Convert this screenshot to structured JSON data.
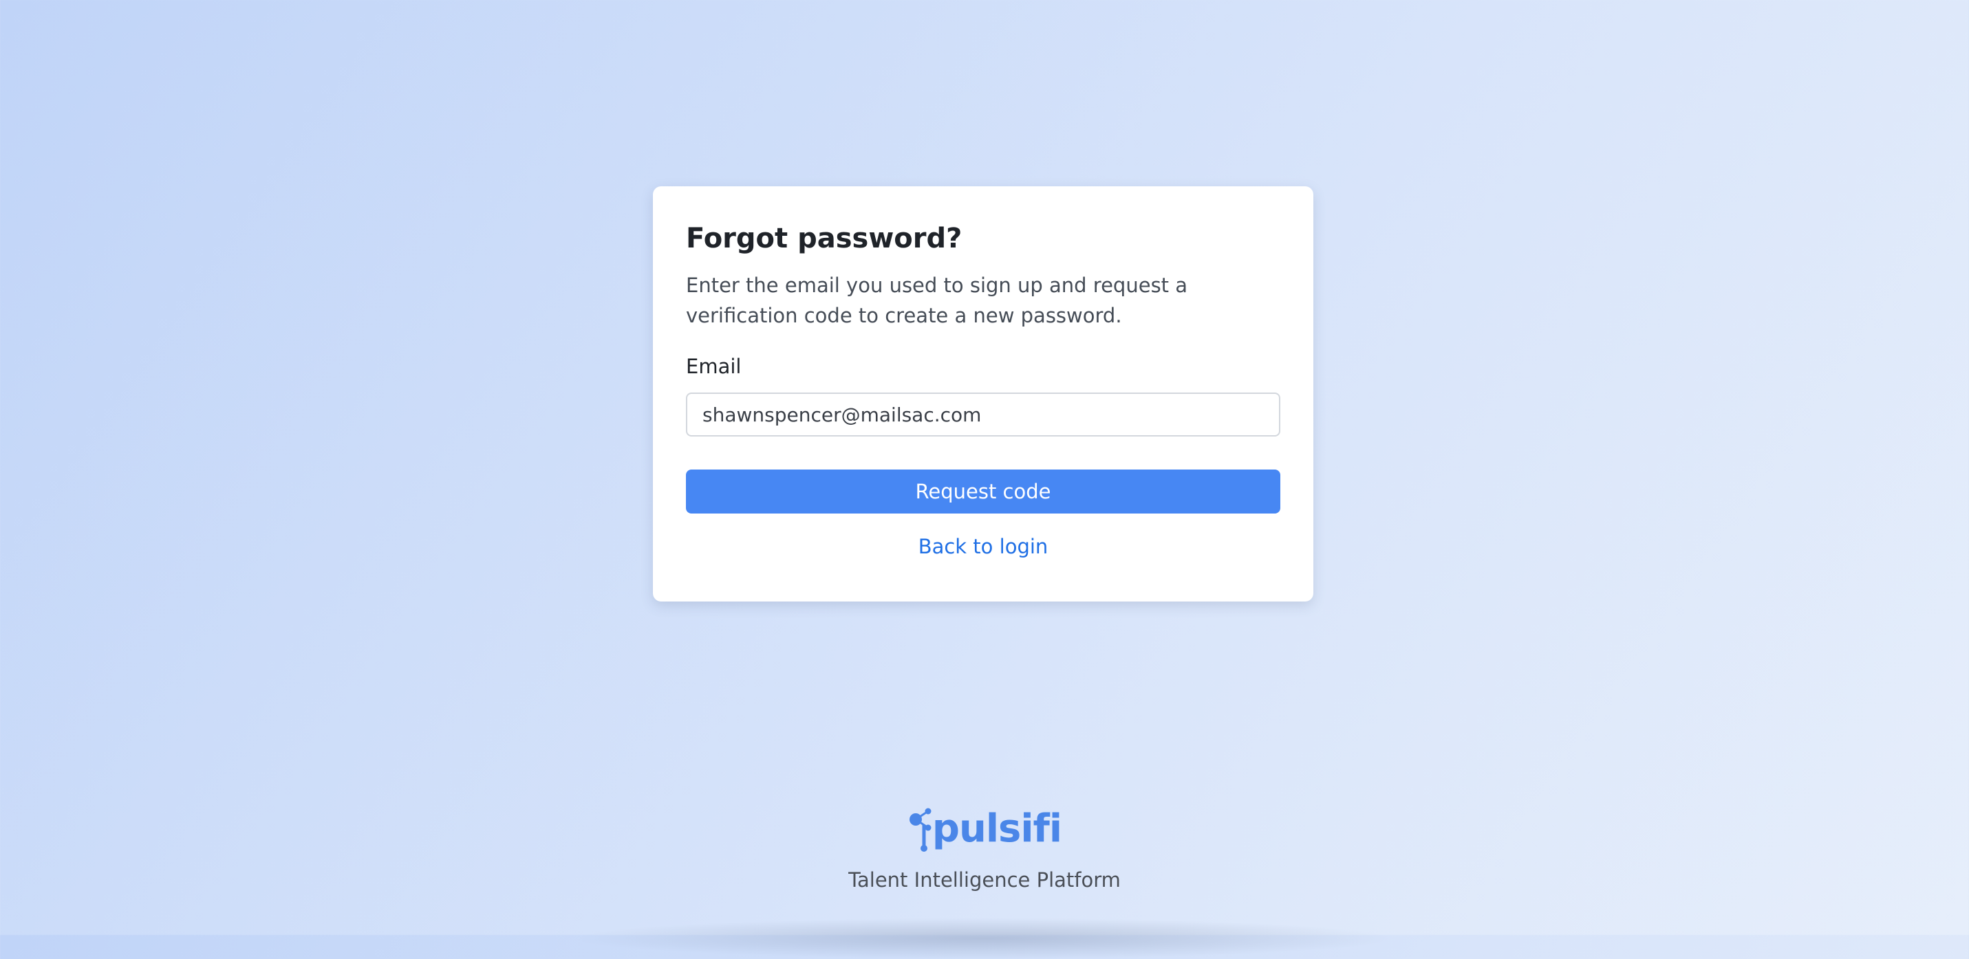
{
  "form": {
    "title": "Forgot password?",
    "description": "Enter the email you used to sign up and request a verification code to create a new password.",
    "email_label": "Email",
    "email_value": "shawnspencer@mailsac.com",
    "submit_label": "Request code",
    "back_link": "Back to login"
  },
  "footer": {
    "logo_text": "pulsifi",
    "logo_icon": "pulsifi-node-icon",
    "tagline": "Talent Intelligence Platform"
  },
  "colors": {
    "accent": "#4787f3",
    "link": "#1f6fe5",
    "brand": "#4a86e8"
  }
}
